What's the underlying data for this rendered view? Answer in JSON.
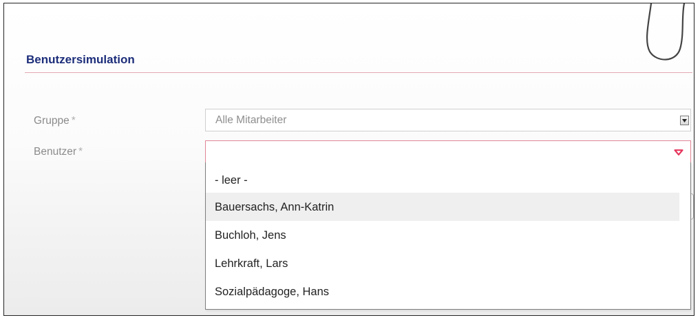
{
  "section": {
    "title": "Benutzersimulation"
  },
  "fields": {
    "gruppe": {
      "label": "Gruppe",
      "required_mark": "*",
      "value": "Alle Mitarbeiter"
    },
    "benutzer": {
      "label": "Benutzer",
      "required_mark": "*",
      "value": ""
    }
  },
  "dropdown": {
    "options": [
      {
        "label": "- leer -"
      },
      {
        "label": "Bauersachs, Ann-Katrin",
        "hovered": true
      },
      {
        "label": "Buchloh, Jens"
      },
      {
        "label": "Lehrkraft, Lars"
      },
      {
        "label": "Sozialpädagoge, Hans"
      }
    ]
  },
  "colors": {
    "title": "#1c2d7a",
    "section_rule": "#e2a8b4",
    "required_border": "#e08595",
    "indicator": "#e5365c"
  },
  "icons": {
    "gruppe_arrow": "dropdown-arrow-icon",
    "benutzer_arrow": "required-dropdown-triangle-icon",
    "decoration": "paperclip-icon"
  }
}
